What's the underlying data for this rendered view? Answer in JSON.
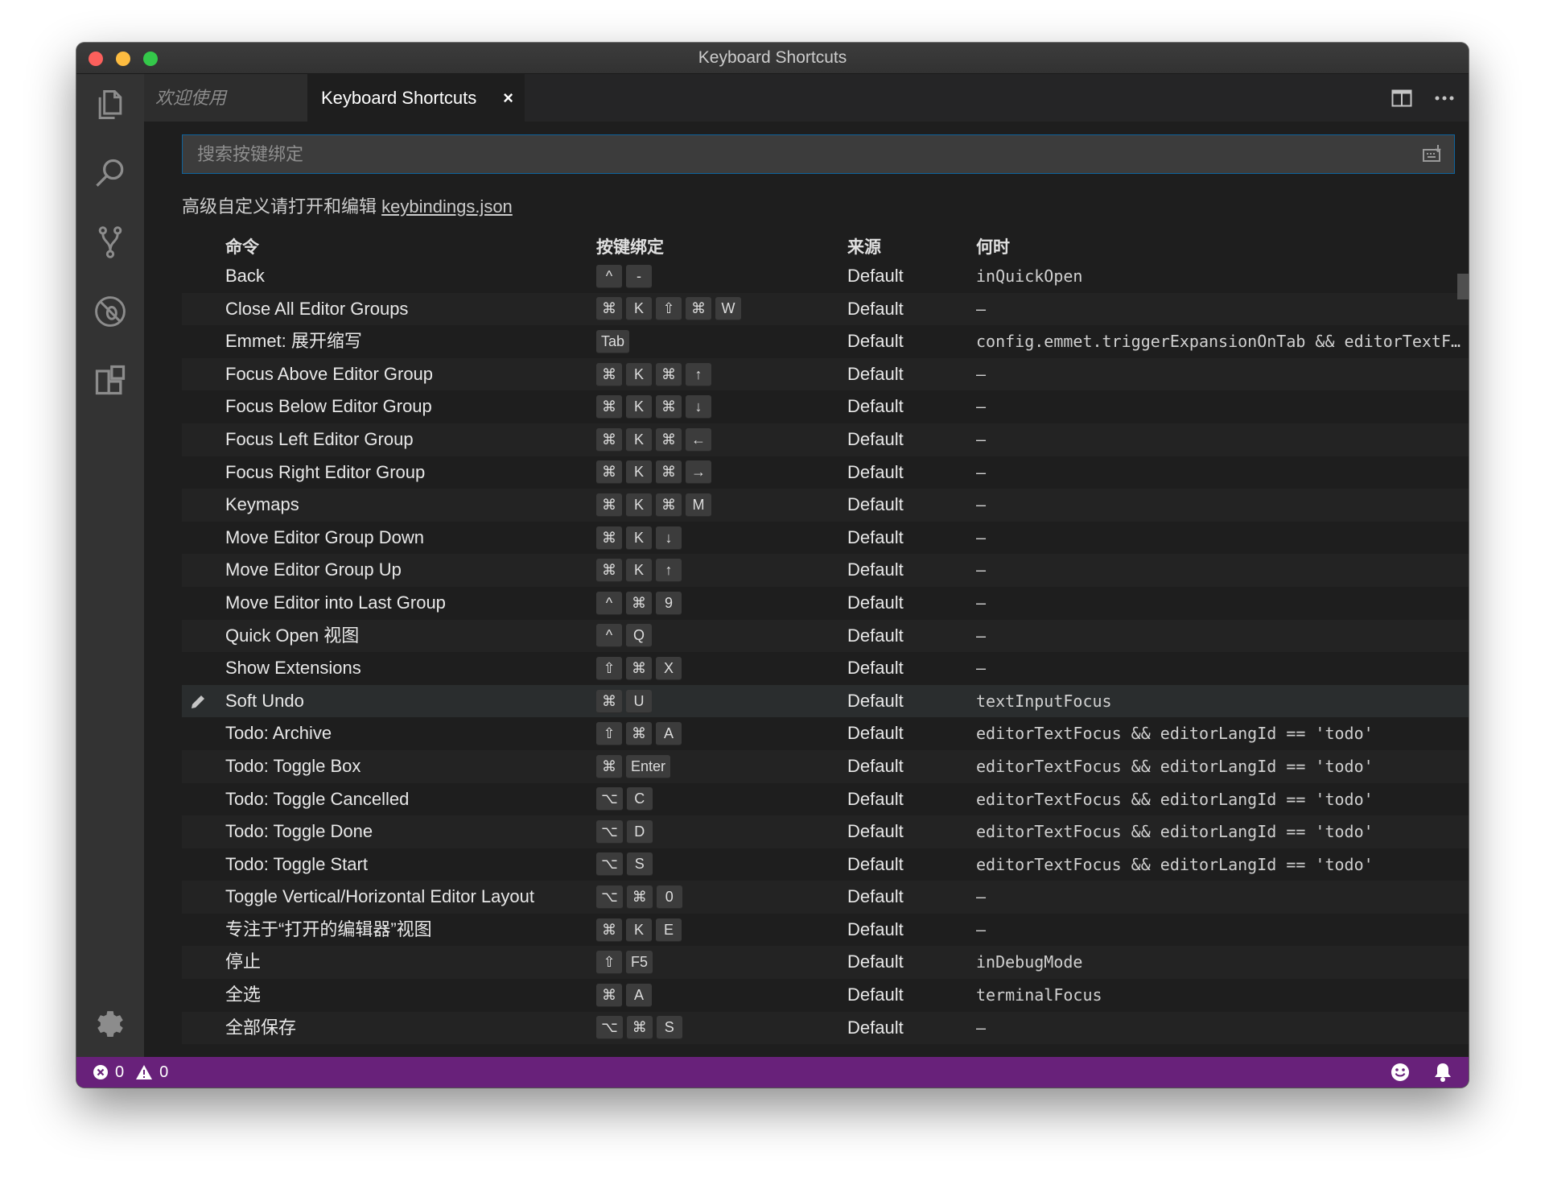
{
  "window": {
    "title": "Keyboard Shortcuts"
  },
  "tabs": [
    {
      "label": "欢迎使用"
    },
    {
      "label": "Keyboard Shortcuts",
      "close": "×"
    }
  ],
  "search": {
    "placeholder": "搜索按键绑定"
  },
  "hint": {
    "text": "高级自定义请打开和编辑 ",
    "link": "keybindings.json"
  },
  "columns": {
    "command": "命令",
    "keybinding": "按键绑定",
    "source": "来源",
    "when": "何时"
  },
  "rows": [
    {
      "command": "Back",
      "keys": [
        "^",
        "-"
      ],
      "source": "Default",
      "when": "inQuickOpen"
    },
    {
      "command": "Close All Editor Groups",
      "keys": [
        "⌘",
        "K",
        "⇧",
        "⌘",
        "W"
      ],
      "source": "Default",
      "when": "—"
    },
    {
      "command": "Emmet: 展开缩写",
      "keys": [
        "Tab"
      ],
      "source": "Default",
      "when": "config.emmet.triggerExpansionOnTab && editorTextFo…"
    },
    {
      "command": "Focus Above Editor Group",
      "keys": [
        "⌘",
        "K",
        "⌘",
        "↑"
      ],
      "source": "Default",
      "when": "—"
    },
    {
      "command": "Focus Below Editor Group",
      "keys": [
        "⌘",
        "K",
        "⌘",
        "↓"
      ],
      "source": "Default",
      "when": "—"
    },
    {
      "command": "Focus Left Editor Group",
      "keys": [
        "⌘",
        "K",
        "⌘",
        "←"
      ],
      "source": "Default",
      "when": "—"
    },
    {
      "command": "Focus Right Editor Group",
      "keys": [
        "⌘",
        "K",
        "⌘",
        "→"
      ],
      "source": "Default",
      "when": "—"
    },
    {
      "command": "Keymaps",
      "keys": [
        "⌘",
        "K",
        "⌘",
        "M"
      ],
      "source": "Default",
      "when": "—"
    },
    {
      "command": "Move Editor Group Down",
      "keys": [
        "⌘",
        "K",
        "↓"
      ],
      "source": "Default",
      "when": "—"
    },
    {
      "command": "Move Editor Group Up",
      "keys": [
        "⌘",
        "K",
        "↑"
      ],
      "source": "Default",
      "when": "—"
    },
    {
      "command": "Move Editor into Last Group",
      "keys": [
        "^",
        "⌘",
        "9"
      ],
      "source": "Default",
      "when": "—"
    },
    {
      "command": "Quick Open 视图",
      "keys": [
        "^",
        "Q"
      ],
      "source": "Default",
      "when": "—"
    },
    {
      "command": "Show Extensions",
      "keys": [
        "⇧",
        "⌘",
        "X"
      ],
      "source": "Default",
      "when": "—"
    },
    {
      "command": "Soft Undo",
      "keys": [
        "⌘",
        "U"
      ],
      "source": "Default",
      "when": "textInputFocus",
      "selected": true
    },
    {
      "command": "Todo: Archive",
      "keys": [
        "⇧",
        "⌘",
        "A"
      ],
      "source": "Default",
      "when": "editorTextFocus && editorLangId == 'todo'"
    },
    {
      "command": "Todo: Toggle Box",
      "keys": [
        "⌘",
        "Enter"
      ],
      "source": "Default",
      "when": "editorTextFocus && editorLangId == 'todo'"
    },
    {
      "command": "Todo: Toggle Cancelled",
      "keys": [
        "⌥",
        "C"
      ],
      "source": "Default",
      "when": "editorTextFocus && editorLangId == 'todo'"
    },
    {
      "command": "Todo: Toggle Done",
      "keys": [
        "⌥",
        "D"
      ],
      "source": "Default",
      "when": "editorTextFocus && editorLangId == 'todo'"
    },
    {
      "command": "Todo: Toggle Start",
      "keys": [
        "⌥",
        "S"
      ],
      "source": "Default",
      "when": "editorTextFocus && editorLangId == 'todo'"
    },
    {
      "command": "Toggle Vertical/Horizontal Editor Layout",
      "keys": [
        "⌥",
        "⌘",
        "0"
      ],
      "source": "Default",
      "when": "—"
    },
    {
      "command": "专注于“打开的编辑器”视图",
      "keys": [
        "⌘",
        "K",
        "E"
      ],
      "source": "Default",
      "when": "—"
    },
    {
      "command": "停止",
      "keys": [
        "⇧",
        "F5"
      ],
      "source": "Default",
      "when": "inDebugMode"
    },
    {
      "command": "全选",
      "keys": [
        "⌘",
        "A"
      ],
      "source": "Default",
      "when": "terminalFocus"
    },
    {
      "command": "全部保存",
      "keys": [
        "⌥",
        "⌘",
        "S"
      ],
      "source": "Default",
      "when": "—"
    }
  ],
  "status": {
    "errors": "0",
    "warnings": "0"
  },
  "colors": {
    "statusbar": "#68217a",
    "focus_border": "#0e639c"
  },
  "icons": [
    "files-icon",
    "search-icon",
    "source-control-icon",
    "debug-icon",
    "extensions-icon",
    "gear-icon",
    "split-editor-icon",
    "more-icon",
    "record-keys-icon",
    "edit-icon",
    "error-icon",
    "warning-icon",
    "smiley-icon",
    "bell-icon"
  ]
}
